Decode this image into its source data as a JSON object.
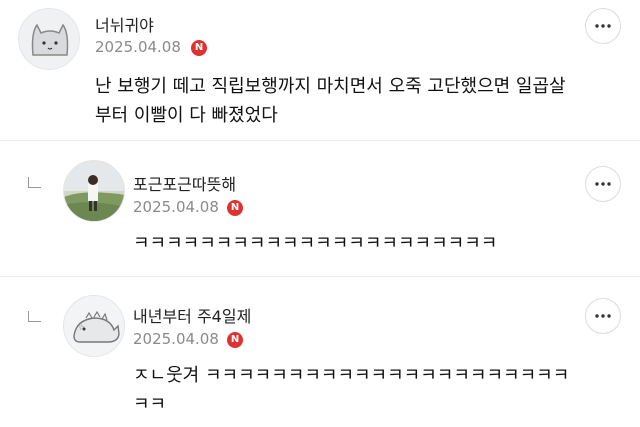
{
  "comments": [
    {
      "author": "너뉘귀야",
      "date": "2025.04.08",
      "badge": "N",
      "text": "난 보행기 떼고 직립보행까지 마치면서 오죽 고단했으면 일곱살\n부터 이빨이 다 빠졌었다",
      "avatar": "cat-avatar-icon"
    },
    {
      "author": "포근포근따뜻해",
      "date": "2025.04.08",
      "badge": "N",
      "text": "ㅋㅋㅋㅋㅋㅋㅋㅋㅋㅋㅋㅋㅋㅋㅋㅋㅋㅋㅋㅋㅋㅋ",
      "avatar": "photo-avatar"
    },
    {
      "author": "내년부터 주4일제",
      "date": "2025.04.08",
      "badge": "N",
      "text": "ㅈㄴ웃겨 ㅋㅋㅋㅋㅋㅋㅋㅋㅋㅋㅋㅋㅋㅋㅋㅋㅋㅋㅋㅋㅋㅋ\nㅋㅋ",
      "avatar": "dinosaur-avatar-icon"
    }
  ],
  "colors": {
    "badge": "#e03131",
    "date": "#8a8a8a"
  }
}
